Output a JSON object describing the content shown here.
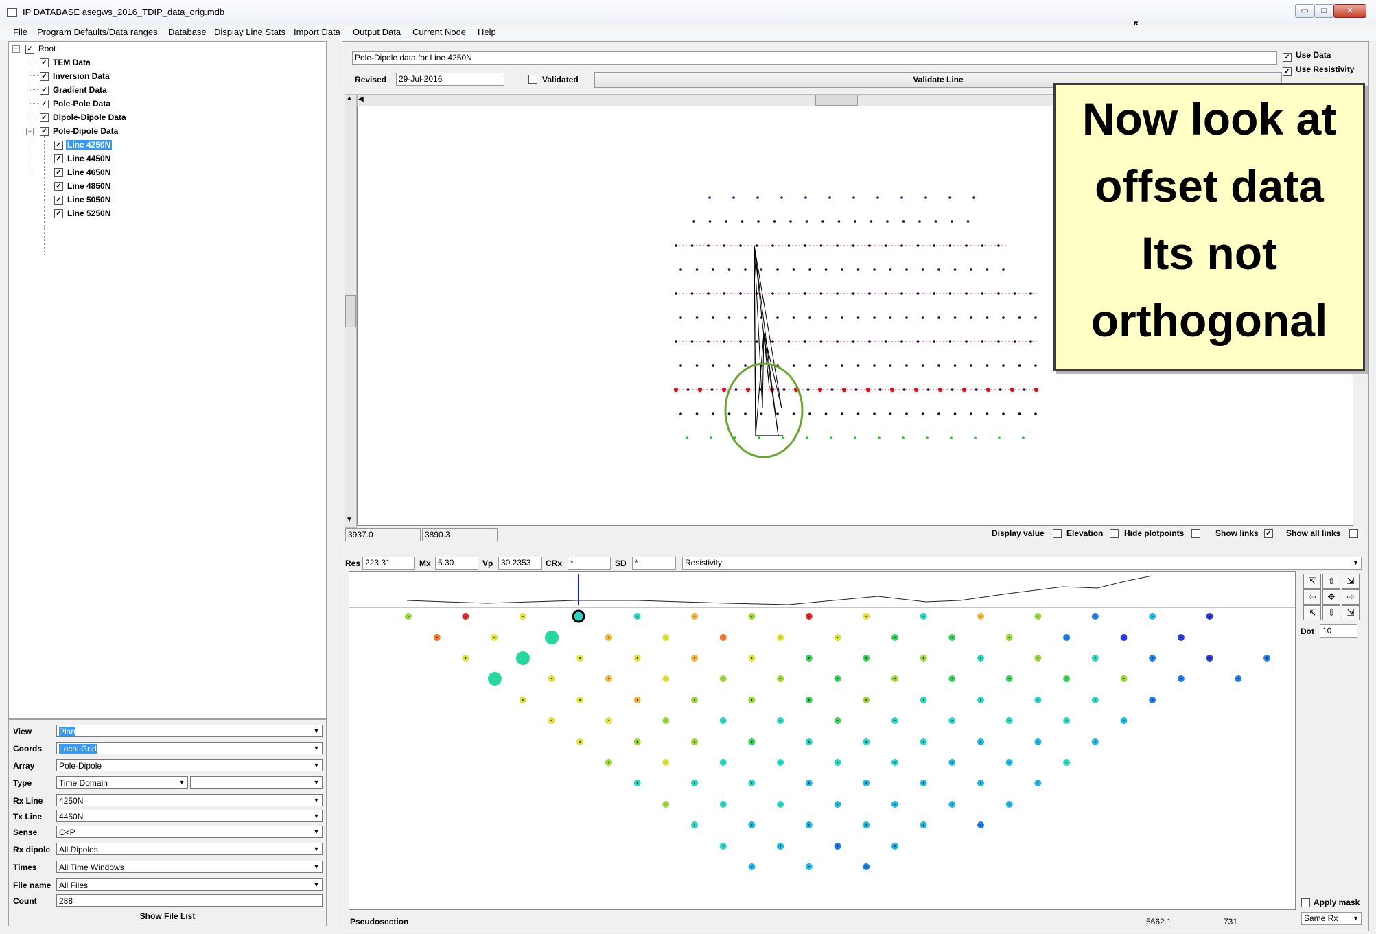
{
  "window": {
    "title": "IP DATABASE asegws_2016_TDIP_data_orig.mdb",
    "buttons": {
      "minimize": "▭",
      "maximize": "□",
      "close": "✕"
    }
  },
  "menu": [
    "File",
    "Program Defaults/Data ranges",
    "Database",
    "Display Line Stats",
    "Import Data",
    "Output Data",
    "Current Node",
    "Help"
  ],
  "tree": {
    "root": "Root",
    "items": [
      "TEM Data",
      "Inversion Data",
      "Gradient Data",
      "Pole-Pole Data",
      "Dipole-Dipole Data",
      "Pole-Dipole Data"
    ],
    "lines": [
      "Line 4250N",
      "Line 4450N",
      "Line 4650N",
      "Line 4850N",
      "Line 5050N",
      "Line 5250N"
    ],
    "selected_line": "Line 4250N"
  },
  "controls": {
    "view": {
      "label": "View",
      "value": "Plan"
    },
    "coords": {
      "label": "Coords",
      "value": "Local Grid"
    },
    "array": {
      "label": "Array",
      "value": "Pole-Dipole"
    },
    "type": {
      "label": "Type",
      "value": "Time Domain",
      "value2": ""
    },
    "rx_line": {
      "label": "Rx Line",
      "value": "4250N"
    },
    "tx_line": {
      "label": "Tx Line",
      "value": "4450N"
    },
    "sense": {
      "label": "Sense",
      "value": "C<P"
    },
    "rx_dipole": {
      "label": "Rx dipole",
      "value": "All Dipoles"
    },
    "times": {
      "label": "Times",
      "value": "All Time Windows"
    },
    "file_name": {
      "label": "File name",
      "value": "All Files"
    },
    "count": {
      "label": "Count",
      "value": "288"
    },
    "show_file_list": "Show File List"
  },
  "header": {
    "description": "Pole-Dipole data for Line 4250N",
    "revised_label": "Revised",
    "revised_value": "29-Jul-2016",
    "validated_label": "Validated",
    "validate_button": "Validate Line",
    "use_data": "Use Data",
    "use_resistivity": "Use Resistivity"
  },
  "plan_status": {
    "x": "3937.0",
    "y": "3890.3",
    "display_value": "Display value",
    "elevation": "Elevation",
    "hide_plotpoints": "Hide plotpoints",
    "show_links": "Show links",
    "show_all_links": "Show all links",
    "show_links_checked": true
  },
  "pseudo_header": {
    "res_label": "Res",
    "res_value": "223.31",
    "mx_label": "Mx",
    "mx_value": "5.30",
    "vp_label": "Vp",
    "vp_value": "30.2353",
    "crx_label": "CRx",
    "crx_value": "*",
    "sd_label": "SD",
    "sd_value": "*",
    "parameter": "Resistivity"
  },
  "pseudo_status": {
    "name": "Pseudosection",
    "x": "5662.1",
    "y": "731"
  },
  "side_controls": {
    "dot_label": "Dot",
    "dot_value": "10",
    "apply_mask": "Apply mask",
    "same_rx": "Same Rx"
  },
  "callout": {
    "line1": "Now look at",
    "line2": "offset data",
    "line3": "Its not",
    "line4": "orthogonal"
  },
  "colors": {
    "selection": "#3399ff",
    "callout_bg": "#ffffc6",
    "circle": "#6aa530"
  }
}
